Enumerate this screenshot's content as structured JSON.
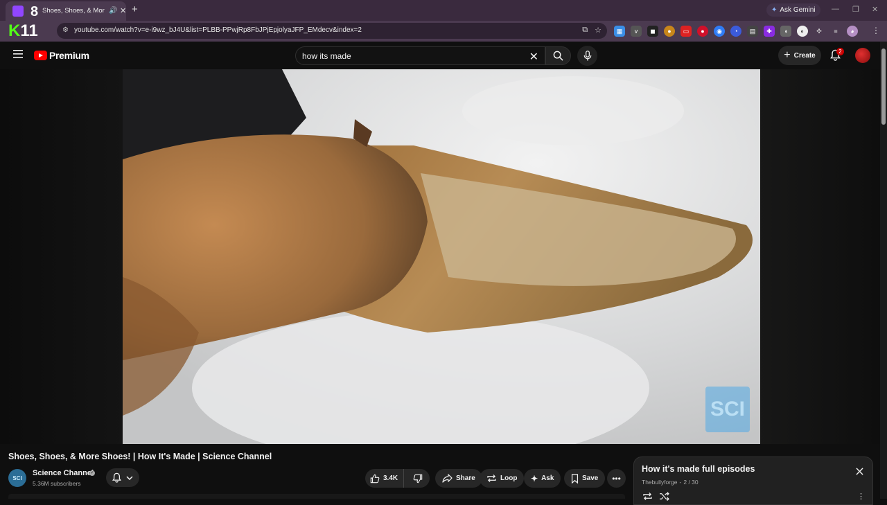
{
  "browser": {
    "tab": {
      "badge": "8",
      "title": "Shoes, Shoes, & More Shoes!",
      "audio_icon": "speaker-icon",
      "close_icon": "close-icon"
    },
    "new_tab_icon": "plus-icon",
    "gemini_label": "Ask Gemini",
    "profile_logo": {
      "k": "K",
      "n": "11"
    },
    "url": "youtube.com/watch?v=e-i9wz_bJ4U&list=PLBB-PPwjRp8FbJPjEpjolyaJFP_EMdecv&index=2",
    "colors": {
      "frame": "#3a2a3e",
      "toolbar": "#4b3a50",
      "kick_green": "#53fc18"
    }
  },
  "masthead": {
    "logo_label": "Premium",
    "search": {
      "value": "how its made",
      "placeholder": "Search"
    },
    "create_label": "Create",
    "notification_count": "2",
    "colors": {
      "youtube_red": "#ff0000",
      "background": "#0f0f0f"
    }
  },
  "video": {
    "title": "Shoes, Shoes, & More Shoes! | How It's Made | Science Channel",
    "watermark": "SCI"
  },
  "channel": {
    "avatar_text": "SCI",
    "name": "Science Channel",
    "subscribers": "5.36M subscribers"
  },
  "actions": {
    "like_count": "3.4K",
    "share_label": "Share",
    "loop_label": "Loop",
    "ask_label": "Ask",
    "save_label": "Save"
  },
  "playlist": {
    "title": "How it's made full episodes",
    "owner": "Thebullyforge",
    "separator": "-",
    "position": "2 / 30"
  }
}
